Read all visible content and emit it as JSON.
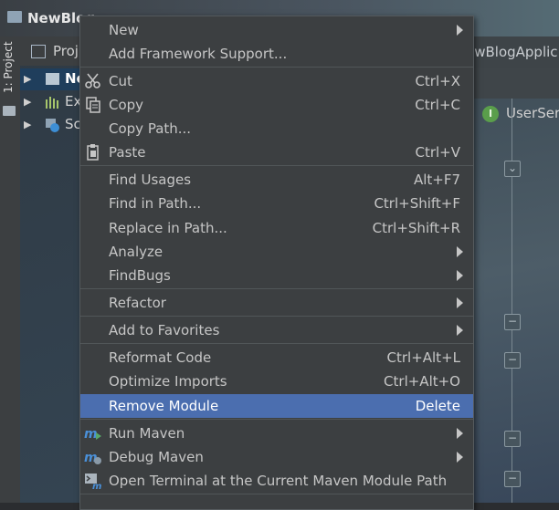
{
  "window": {
    "title": "NewBlog",
    "right_tab_label": "ewBlogApplic"
  },
  "sidebar": {
    "tool_window_label": "1: Project"
  },
  "project_panel": {
    "tab_label": "Proj",
    "tree": [
      {
        "label": "Ne",
        "selected": true,
        "icon": "module-folder-icon"
      },
      {
        "label": "Ex",
        "selected": false,
        "icon": "external-libraries-icon"
      },
      {
        "label": "Sc",
        "selected": false,
        "icon": "scratches-icon"
      }
    ]
  },
  "editor": {
    "tab_label": "UserSer",
    "tab_badge": "I"
  },
  "context_menu": {
    "items": [
      {
        "label": "New",
        "shortcut": "",
        "submenu": true,
        "icon": ""
      },
      {
        "label": "Add Framework Support...",
        "shortcut": "",
        "submenu": false,
        "icon": ""
      },
      {
        "label": "Cut",
        "shortcut": "Ctrl+X",
        "submenu": false,
        "icon": "scissors-icon"
      },
      {
        "label": "Copy",
        "shortcut": "Ctrl+C",
        "submenu": false,
        "icon": "copy-icon"
      },
      {
        "label": "Copy Path...",
        "shortcut": "",
        "submenu": false,
        "icon": ""
      },
      {
        "label": "Paste",
        "shortcut": "Ctrl+V",
        "submenu": false,
        "icon": "clipboard-icon"
      },
      {
        "label": "Find Usages",
        "shortcut": "Alt+F7",
        "submenu": false,
        "icon": ""
      },
      {
        "label": "Find in Path...",
        "shortcut": "Ctrl+Shift+F",
        "submenu": false,
        "icon": ""
      },
      {
        "label": "Replace in Path...",
        "shortcut": "Ctrl+Shift+R",
        "submenu": false,
        "icon": ""
      },
      {
        "label": "Analyze",
        "shortcut": "",
        "submenu": true,
        "icon": ""
      },
      {
        "label": "FindBugs",
        "shortcut": "",
        "submenu": true,
        "icon": ""
      },
      {
        "label": "Refactor",
        "shortcut": "",
        "submenu": true,
        "icon": ""
      },
      {
        "label": "Add to Favorites",
        "shortcut": "",
        "submenu": true,
        "icon": ""
      },
      {
        "label": "Reformat Code",
        "shortcut": "Ctrl+Alt+L",
        "submenu": false,
        "icon": ""
      },
      {
        "label": "Optimize Imports",
        "shortcut": "Ctrl+Alt+O",
        "submenu": false,
        "icon": ""
      },
      {
        "label": "Remove Module",
        "shortcut": "Delete",
        "submenu": false,
        "icon": "",
        "highlighted": true
      },
      {
        "label": "Run Maven",
        "shortcut": "",
        "submenu": true,
        "icon": "maven-run-icon"
      },
      {
        "label": "Debug Maven",
        "shortcut": "",
        "submenu": true,
        "icon": "maven-debug-icon"
      },
      {
        "label": "Open Terminal at the Current Maven Module Path",
        "shortcut": "",
        "submenu": false,
        "icon": "terminal-icon"
      }
    ]
  },
  "colors": {
    "menu_bg": "#3c3f41",
    "highlight": "#4b6eaf",
    "selection": "#1f3e5c",
    "text": "#c6c6c6"
  }
}
